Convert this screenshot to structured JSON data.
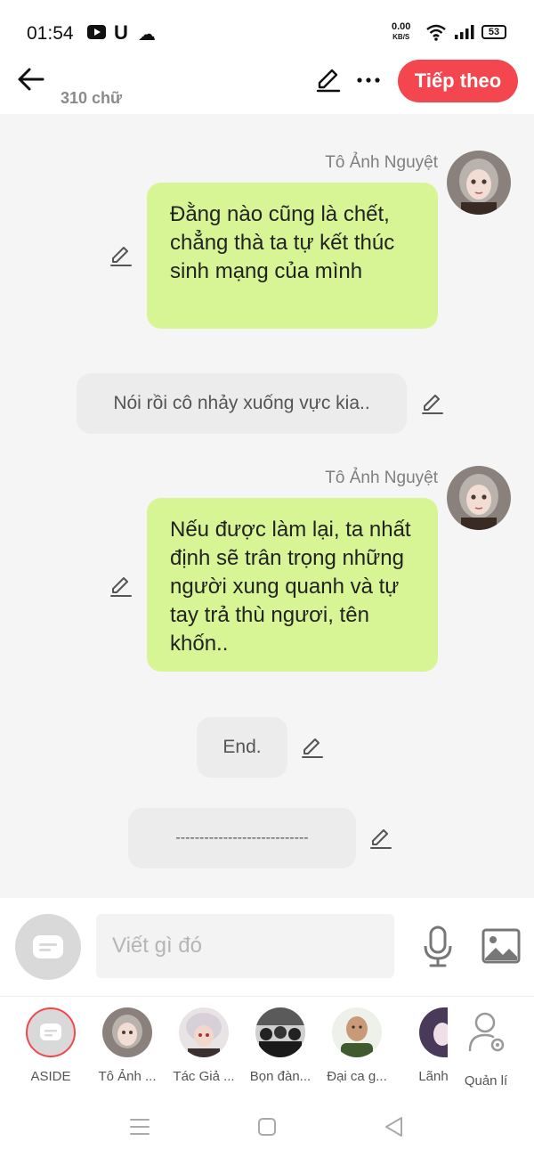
{
  "status_bar": {
    "time": "01:54",
    "net_speed_value": "0.00",
    "net_speed_unit": "KB/S",
    "battery": "53",
    "icons": [
      "youtube-icon",
      "u-app-icon",
      "cloud-icon",
      "wifi-icon",
      "signal-icon",
      "battery-icon"
    ]
  },
  "header": {
    "word_count": "310 chữ",
    "next_label": "Tiếp theo",
    "accent_color": "#f4464f"
  },
  "messages": [
    {
      "type": "character",
      "speaker": "Tô Ảnh Nguyệt",
      "text": "Đằng nào cũng là chết, chẳng thà ta tự kết thúc sinh mạng của mình"
    },
    {
      "type": "aside",
      "text": "Nói rồi cô nhảy xuống vực kia.."
    },
    {
      "type": "character",
      "speaker": "Tô Ảnh Nguyệt",
      "text": "Nếu được làm lại, ta nhất định sẽ trân trọng những người xung quanh và tự tay trả thù ngươi, tên khốn.."
    },
    {
      "type": "aside",
      "text": "End."
    },
    {
      "type": "aside",
      "text": "----------------------------"
    }
  ],
  "composer": {
    "placeholder": "Viết gì đó"
  },
  "characters": [
    {
      "label": "ASIDE"
    },
    {
      "label": "Tô Ảnh ..."
    },
    {
      "label": "Tác Giả ..."
    },
    {
      "label": "Bọn đàn..."
    },
    {
      "label": "Đại ca g..."
    },
    {
      "label": "Lãnh"
    },
    {
      "label": "Quản lí"
    }
  ],
  "colors": {
    "bubble_green": "#d7f594",
    "bubble_gray": "#ececec",
    "chat_bg": "#f5f5f5"
  }
}
